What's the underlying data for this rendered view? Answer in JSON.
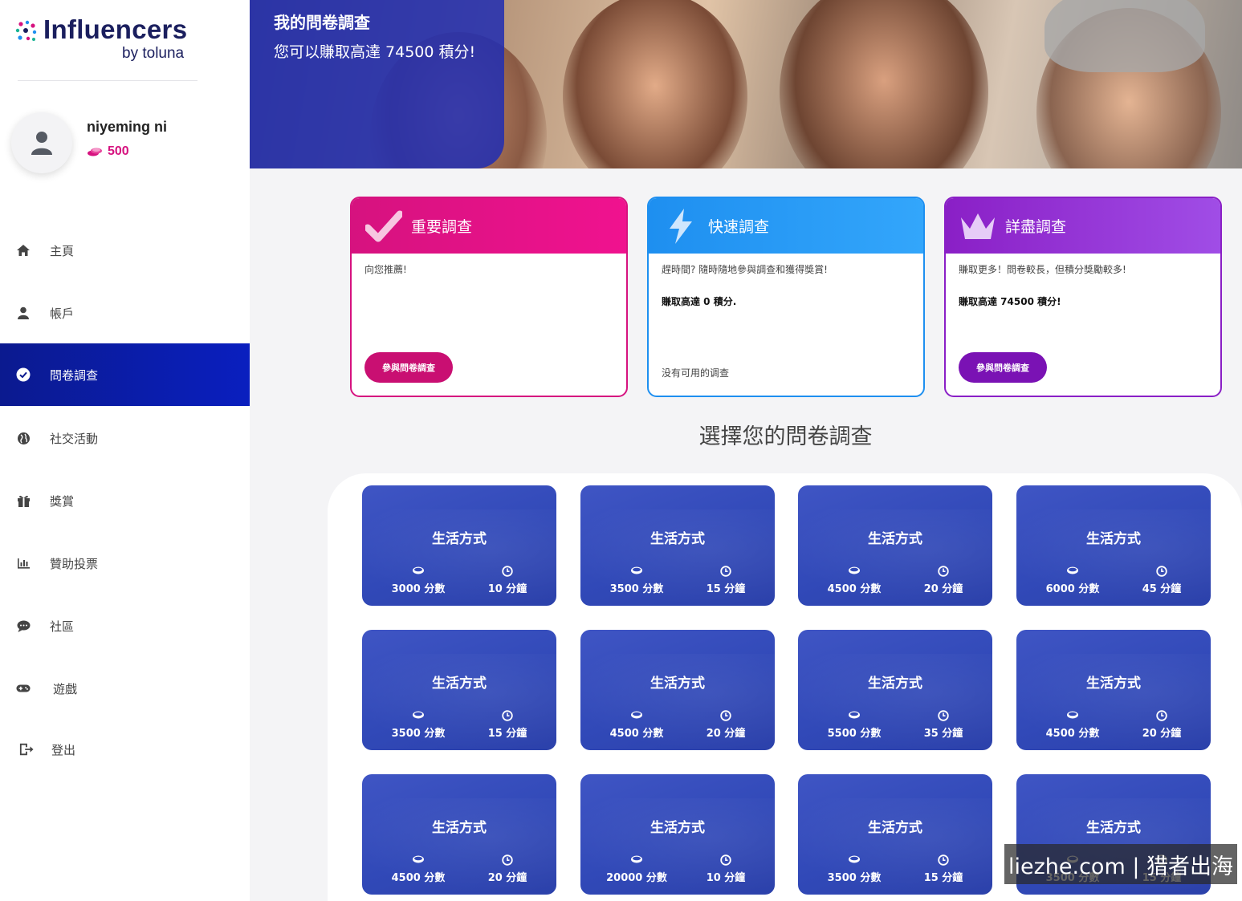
{
  "brand": {
    "name": "Influencers",
    "sub": "by toluna"
  },
  "user": {
    "name": "niyeming ni",
    "points": "500"
  },
  "nav": [
    {
      "label": "主頁",
      "icon": "home-icon"
    },
    {
      "label": "帳戶",
      "icon": "user-icon"
    },
    {
      "label": "問卷調查",
      "icon": "check-circle-icon",
      "active": true
    },
    {
      "label": "社交活動",
      "icon": "globe-icon"
    },
    {
      "label": "獎賞",
      "icon": "gift-icon"
    },
    {
      "label": "贊助投票",
      "icon": "bar-chart-icon"
    },
    {
      "label": "社區",
      "icon": "chat-icon"
    },
    {
      "label": "遊戲",
      "icon": "gamepad-icon"
    },
    {
      "label": "登出",
      "icon": "logout-icon"
    }
  ],
  "hero": {
    "title": "我的問卷調查",
    "subtitle": "您可以賺取高達 74500 積分!"
  },
  "categories": [
    {
      "title": "重要調查",
      "desc": "向您推薦!",
      "button": "參與問卷調查",
      "color": "#d6127f",
      "icon": "checkmark-icon"
    },
    {
      "title": "快速調查",
      "desc": "趕時間? 隨時隨地參與調查和獲得獎賞!",
      "bonus": "賺取高達 0 積分.",
      "empty": "没有可用的调查",
      "color": "#1e8ff0",
      "icon": "lightning-icon"
    },
    {
      "title": "詳盡調查",
      "desc": "賺取更多！問卷較長，但積分獎勵較多!",
      "bonus": "賺取高達 74500 積分!",
      "button": "參與問卷調查",
      "color": "#8a1fc6",
      "icon": "crown-icon"
    }
  ],
  "section_title": "選擇您的問卷調查",
  "surveys": [
    {
      "title": "生活方式",
      "points": "3000 分數",
      "duration": "10 分鐘"
    },
    {
      "title": "生活方式",
      "points": "3500 分數",
      "duration": "15 分鐘"
    },
    {
      "title": "生活方式",
      "points": "4500 分數",
      "duration": "20 分鐘"
    },
    {
      "title": "生活方式",
      "points": "6000 分數",
      "duration": "45 分鐘"
    },
    {
      "title": "生活方式",
      "points": "3500 分數",
      "duration": "15 分鐘"
    },
    {
      "title": "生活方式",
      "points": "4500 分數",
      "duration": "20 分鐘"
    },
    {
      "title": "生活方式",
      "points": "5500 分數",
      "duration": "35 分鐘"
    },
    {
      "title": "生活方式",
      "points": "4500 分數",
      "duration": "20 分鐘"
    },
    {
      "title": "生活方式",
      "points": "4500 分數",
      "duration": "20 分鐘"
    },
    {
      "title": "生活方式",
      "points": "20000 分數",
      "duration": "10 分鐘"
    },
    {
      "title": "生活方式",
      "points": "3500 分數",
      "duration": "15 分鐘"
    },
    {
      "title": "生活方式",
      "points": "3500 分數",
      "duration": "15 分鐘"
    }
  ],
  "watermark": "liezhe.com | 猎者出海"
}
